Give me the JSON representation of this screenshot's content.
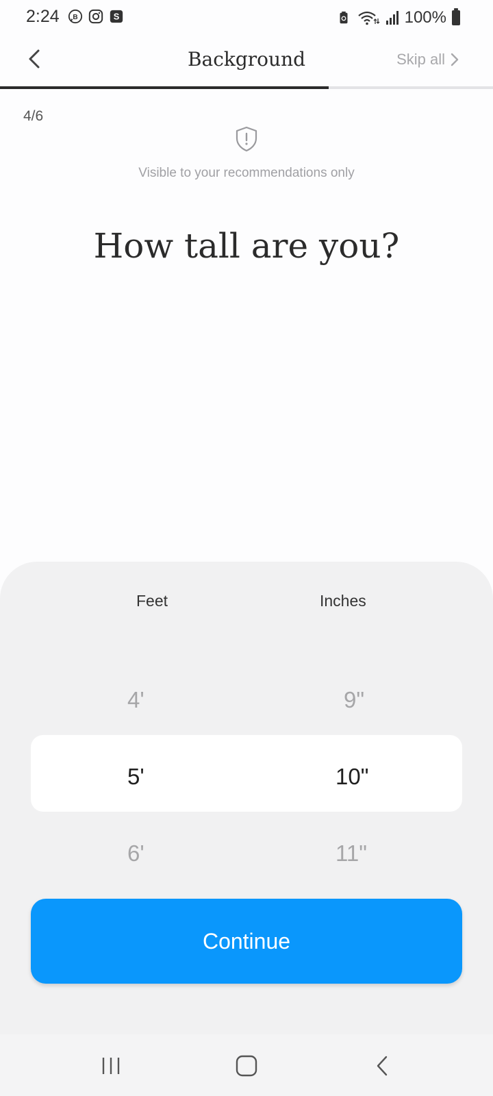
{
  "status": {
    "time": "2:24",
    "battery": "100%",
    "left_icons": [
      "business-chat-icon",
      "instagram-icon",
      "s-app-icon"
    ],
    "right_icons": [
      "battery-saver-icon",
      "wifi-icon",
      "signal-icon",
      "battery-icon"
    ]
  },
  "header": {
    "back_icon": "chevron-left-icon",
    "title": "Background",
    "skip_label": "Skip all",
    "skip_icon": "chevron-right-icon",
    "progress": 0.667
  },
  "step": {
    "counter": "4/6"
  },
  "privacy": {
    "icon": "shield-icon",
    "note": "Visible to your recommendations only"
  },
  "question": "How tall are you?",
  "picker": {
    "feet_label": "Feet",
    "inches_label": "Inches",
    "feet": {
      "prev": "4'",
      "selected": "5'",
      "next": "6'"
    },
    "inches": {
      "prev": "9\"",
      "selected": "10\"",
      "next": "11\""
    }
  },
  "continue_label": "Continue",
  "colors": {
    "accent": "#0a97fc",
    "sheet": "#f1f1f2",
    "text": "#2b2b2b"
  },
  "navbar": {
    "icons": [
      "recent-apps-icon",
      "home-icon",
      "back-icon"
    ]
  }
}
